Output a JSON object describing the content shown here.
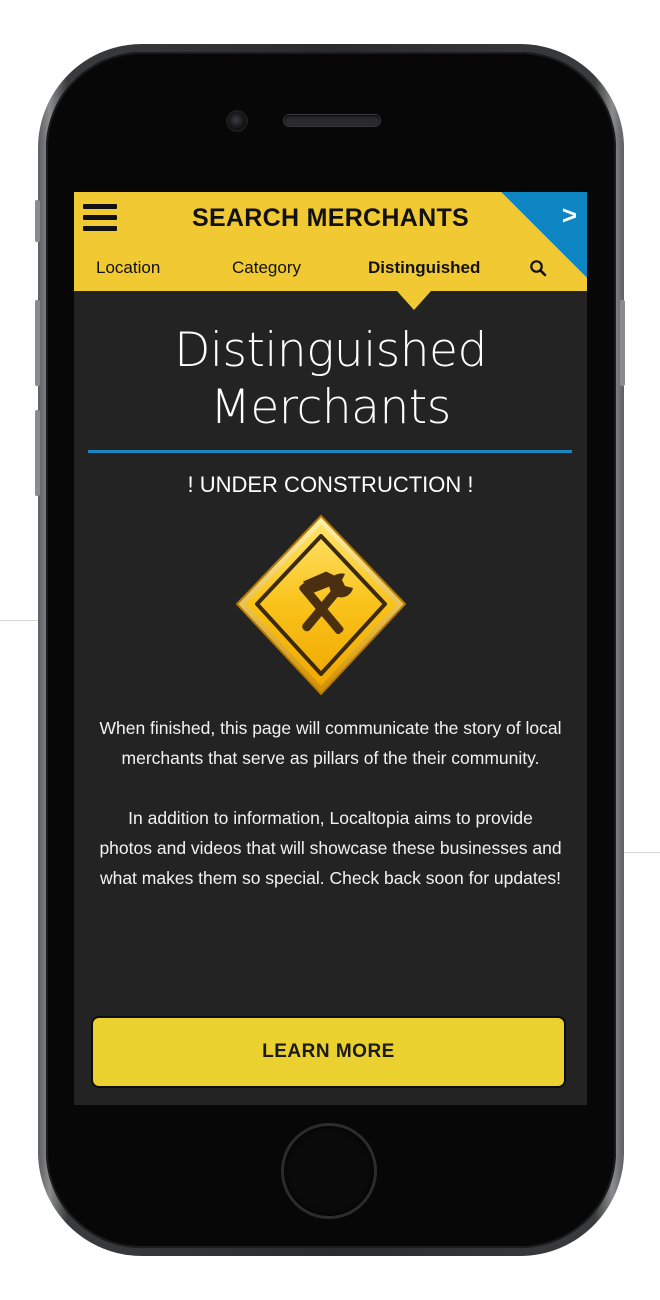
{
  "header": {
    "title": "SEARCH MERCHANTS",
    "next_arrow": ">",
    "menu_icon": "hamburger-menu-icon",
    "tabs": [
      {
        "label": "Location",
        "active": false
      },
      {
        "label": "Category",
        "active": false
      },
      {
        "label": "Distinguished",
        "active": true
      }
    ],
    "search_icon": "search-icon"
  },
  "main": {
    "title_line1": "Distinguished",
    "title_line2": "Merchants",
    "construction_notice": "! UNDER CONSTRUCTION !",
    "sign_icon": "construction-sign-icon",
    "paragraph1_line1": "When finished, this page will communicate the story of local",
    "paragraph1_line2": "merchants that serve as pillars of the their community.",
    "paragraph2_line1": "In addition to information, Localtopia aims to provide",
    "paragraph2_line2": "photos and videos that will showcase these businesses and",
    "paragraph2_line3": "what makes them so special. Check back soon for updates!",
    "button_label": "LEARN MORE"
  },
  "colors": {
    "header_yellow": "#f1c932",
    "accent_blue": "#0e86c3",
    "screen_bg": "#232323",
    "button_yellow": "#ead12f"
  }
}
